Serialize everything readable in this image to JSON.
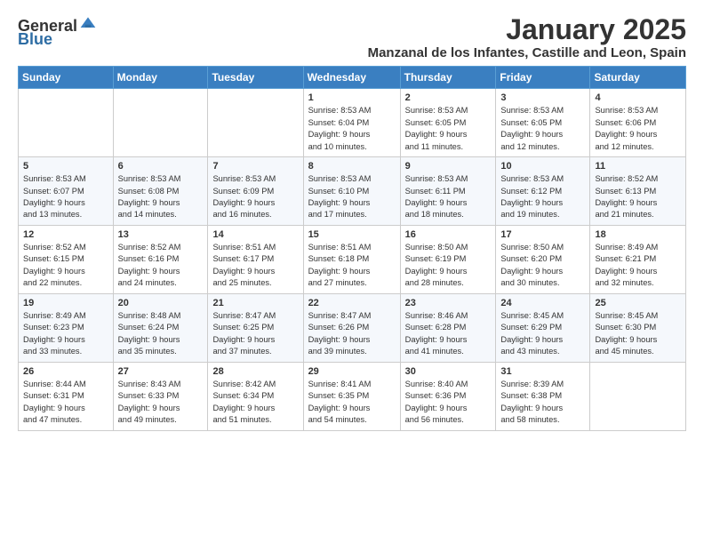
{
  "header": {
    "logo_general": "General",
    "logo_blue": "Blue",
    "month_title": "January 2025",
    "location": "Manzanal de los Infantes, Castille and Leon, Spain"
  },
  "days_of_week": [
    "Sunday",
    "Monday",
    "Tuesday",
    "Wednesday",
    "Thursday",
    "Friday",
    "Saturday"
  ],
  "weeks": [
    [
      {
        "day": "",
        "info": ""
      },
      {
        "day": "",
        "info": ""
      },
      {
        "day": "",
        "info": ""
      },
      {
        "day": "1",
        "info": "Sunrise: 8:53 AM\nSunset: 6:04 PM\nDaylight: 9 hours\nand 10 minutes."
      },
      {
        "day": "2",
        "info": "Sunrise: 8:53 AM\nSunset: 6:05 PM\nDaylight: 9 hours\nand 11 minutes."
      },
      {
        "day": "3",
        "info": "Sunrise: 8:53 AM\nSunset: 6:05 PM\nDaylight: 9 hours\nand 12 minutes."
      },
      {
        "day": "4",
        "info": "Sunrise: 8:53 AM\nSunset: 6:06 PM\nDaylight: 9 hours\nand 12 minutes."
      }
    ],
    [
      {
        "day": "5",
        "info": "Sunrise: 8:53 AM\nSunset: 6:07 PM\nDaylight: 9 hours\nand 13 minutes."
      },
      {
        "day": "6",
        "info": "Sunrise: 8:53 AM\nSunset: 6:08 PM\nDaylight: 9 hours\nand 14 minutes."
      },
      {
        "day": "7",
        "info": "Sunrise: 8:53 AM\nSunset: 6:09 PM\nDaylight: 9 hours\nand 16 minutes."
      },
      {
        "day": "8",
        "info": "Sunrise: 8:53 AM\nSunset: 6:10 PM\nDaylight: 9 hours\nand 17 minutes."
      },
      {
        "day": "9",
        "info": "Sunrise: 8:53 AM\nSunset: 6:11 PM\nDaylight: 9 hours\nand 18 minutes."
      },
      {
        "day": "10",
        "info": "Sunrise: 8:53 AM\nSunset: 6:12 PM\nDaylight: 9 hours\nand 19 minutes."
      },
      {
        "day": "11",
        "info": "Sunrise: 8:52 AM\nSunset: 6:13 PM\nDaylight: 9 hours\nand 21 minutes."
      }
    ],
    [
      {
        "day": "12",
        "info": "Sunrise: 8:52 AM\nSunset: 6:15 PM\nDaylight: 9 hours\nand 22 minutes."
      },
      {
        "day": "13",
        "info": "Sunrise: 8:52 AM\nSunset: 6:16 PM\nDaylight: 9 hours\nand 24 minutes."
      },
      {
        "day": "14",
        "info": "Sunrise: 8:51 AM\nSunset: 6:17 PM\nDaylight: 9 hours\nand 25 minutes."
      },
      {
        "day": "15",
        "info": "Sunrise: 8:51 AM\nSunset: 6:18 PM\nDaylight: 9 hours\nand 27 minutes."
      },
      {
        "day": "16",
        "info": "Sunrise: 8:50 AM\nSunset: 6:19 PM\nDaylight: 9 hours\nand 28 minutes."
      },
      {
        "day": "17",
        "info": "Sunrise: 8:50 AM\nSunset: 6:20 PM\nDaylight: 9 hours\nand 30 minutes."
      },
      {
        "day": "18",
        "info": "Sunrise: 8:49 AM\nSunset: 6:21 PM\nDaylight: 9 hours\nand 32 minutes."
      }
    ],
    [
      {
        "day": "19",
        "info": "Sunrise: 8:49 AM\nSunset: 6:23 PM\nDaylight: 9 hours\nand 33 minutes."
      },
      {
        "day": "20",
        "info": "Sunrise: 8:48 AM\nSunset: 6:24 PM\nDaylight: 9 hours\nand 35 minutes."
      },
      {
        "day": "21",
        "info": "Sunrise: 8:47 AM\nSunset: 6:25 PM\nDaylight: 9 hours\nand 37 minutes."
      },
      {
        "day": "22",
        "info": "Sunrise: 8:47 AM\nSunset: 6:26 PM\nDaylight: 9 hours\nand 39 minutes."
      },
      {
        "day": "23",
        "info": "Sunrise: 8:46 AM\nSunset: 6:28 PM\nDaylight: 9 hours\nand 41 minutes."
      },
      {
        "day": "24",
        "info": "Sunrise: 8:45 AM\nSunset: 6:29 PM\nDaylight: 9 hours\nand 43 minutes."
      },
      {
        "day": "25",
        "info": "Sunrise: 8:45 AM\nSunset: 6:30 PM\nDaylight: 9 hours\nand 45 minutes."
      }
    ],
    [
      {
        "day": "26",
        "info": "Sunrise: 8:44 AM\nSunset: 6:31 PM\nDaylight: 9 hours\nand 47 minutes."
      },
      {
        "day": "27",
        "info": "Sunrise: 8:43 AM\nSunset: 6:33 PM\nDaylight: 9 hours\nand 49 minutes."
      },
      {
        "day": "28",
        "info": "Sunrise: 8:42 AM\nSunset: 6:34 PM\nDaylight: 9 hours\nand 51 minutes."
      },
      {
        "day": "29",
        "info": "Sunrise: 8:41 AM\nSunset: 6:35 PM\nDaylight: 9 hours\nand 54 minutes."
      },
      {
        "day": "30",
        "info": "Sunrise: 8:40 AM\nSunset: 6:36 PM\nDaylight: 9 hours\nand 56 minutes."
      },
      {
        "day": "31",
        "info": "Sunrise: 8:39 AM\nSunset: 6:38 PM\nDaylight: 9 hours\nand 58 minutes."
      },
      {
        "day": "",
        "info": ""
      }
    ]
  ]
}
